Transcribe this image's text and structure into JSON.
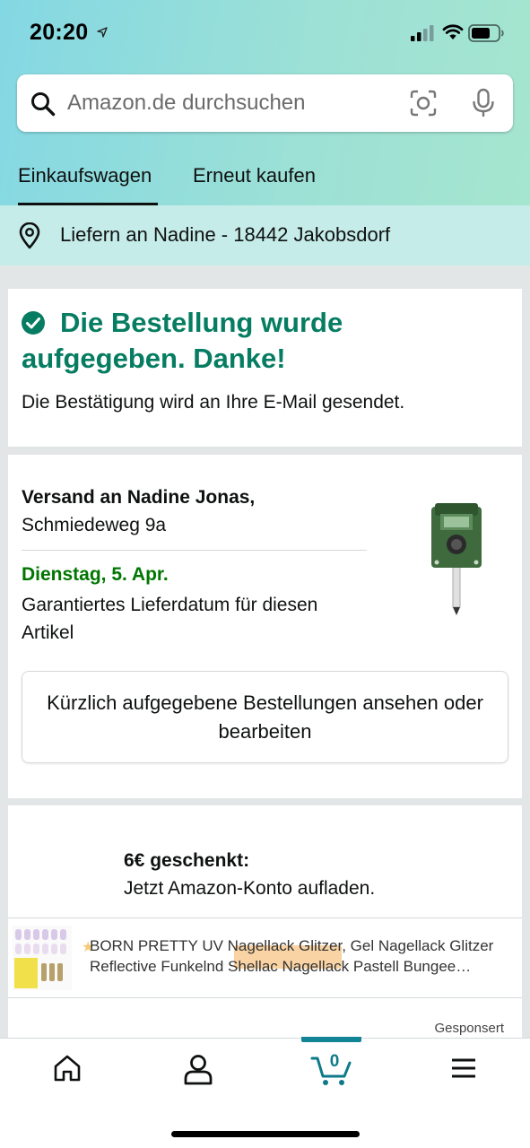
{
  "status_bar": {
    "time": "20:20"
  },
  "search": {
    "placeholder": "Amazon.de durchsuchen"
  },
  "tabs": [
    {
      "label": "Einkaufswagen",
      "active": true
    },
    {
      "label": "Erneut kaufen",
      "active": false
    }
  ],
  "delivery_bar": {
    "text": "Liefern an Nadine - 18442 Jakobsdorf"
  },
  "confirmation": {
    "title": "Die Bestellung wurde aufgegeben. Danke!",
    "subtitle": "Die Bestätigung wird an Ihre E-Mail gesendet."
  },
  "shipment": {
    "ship_to": "Versand an Nadine Jonas,",
    "street": "Schmiedeweg 9a",
    "date": "Dienstag, 5. Apr.",
    "note": "Garantiertes Lieferdatum für diesen Artikel",
    "orders_button": "Kürzlich aufgegebene Bestellungen ansehen oder bearbeiten"
  },
  "promo": {
    "title": "6€ geschenkt:",
    "subtitle": "Jetzt Amazon-Konto aufladen."
  },
  "ad": {
    "line1": "BORN PRETTY UV Nagellack Glitzer, Gel Nagellack Glitzer",
    "line2": "Reflective Funkelnd Shellac Nagellack Pastell Bungee…",
    "sponsored": "Gesponsert"
  },
  "bottom_nav": {
    "items": [
      "home-icon",
      "profile-icon",
      "cart-icon",
      "menu-icon"
    ],
    "cart_count": "0",
    "accent": "#138496"
  },
  "colors": {
    "success": "#067d62",
    "delivery_date": "#007600"
  }
}
